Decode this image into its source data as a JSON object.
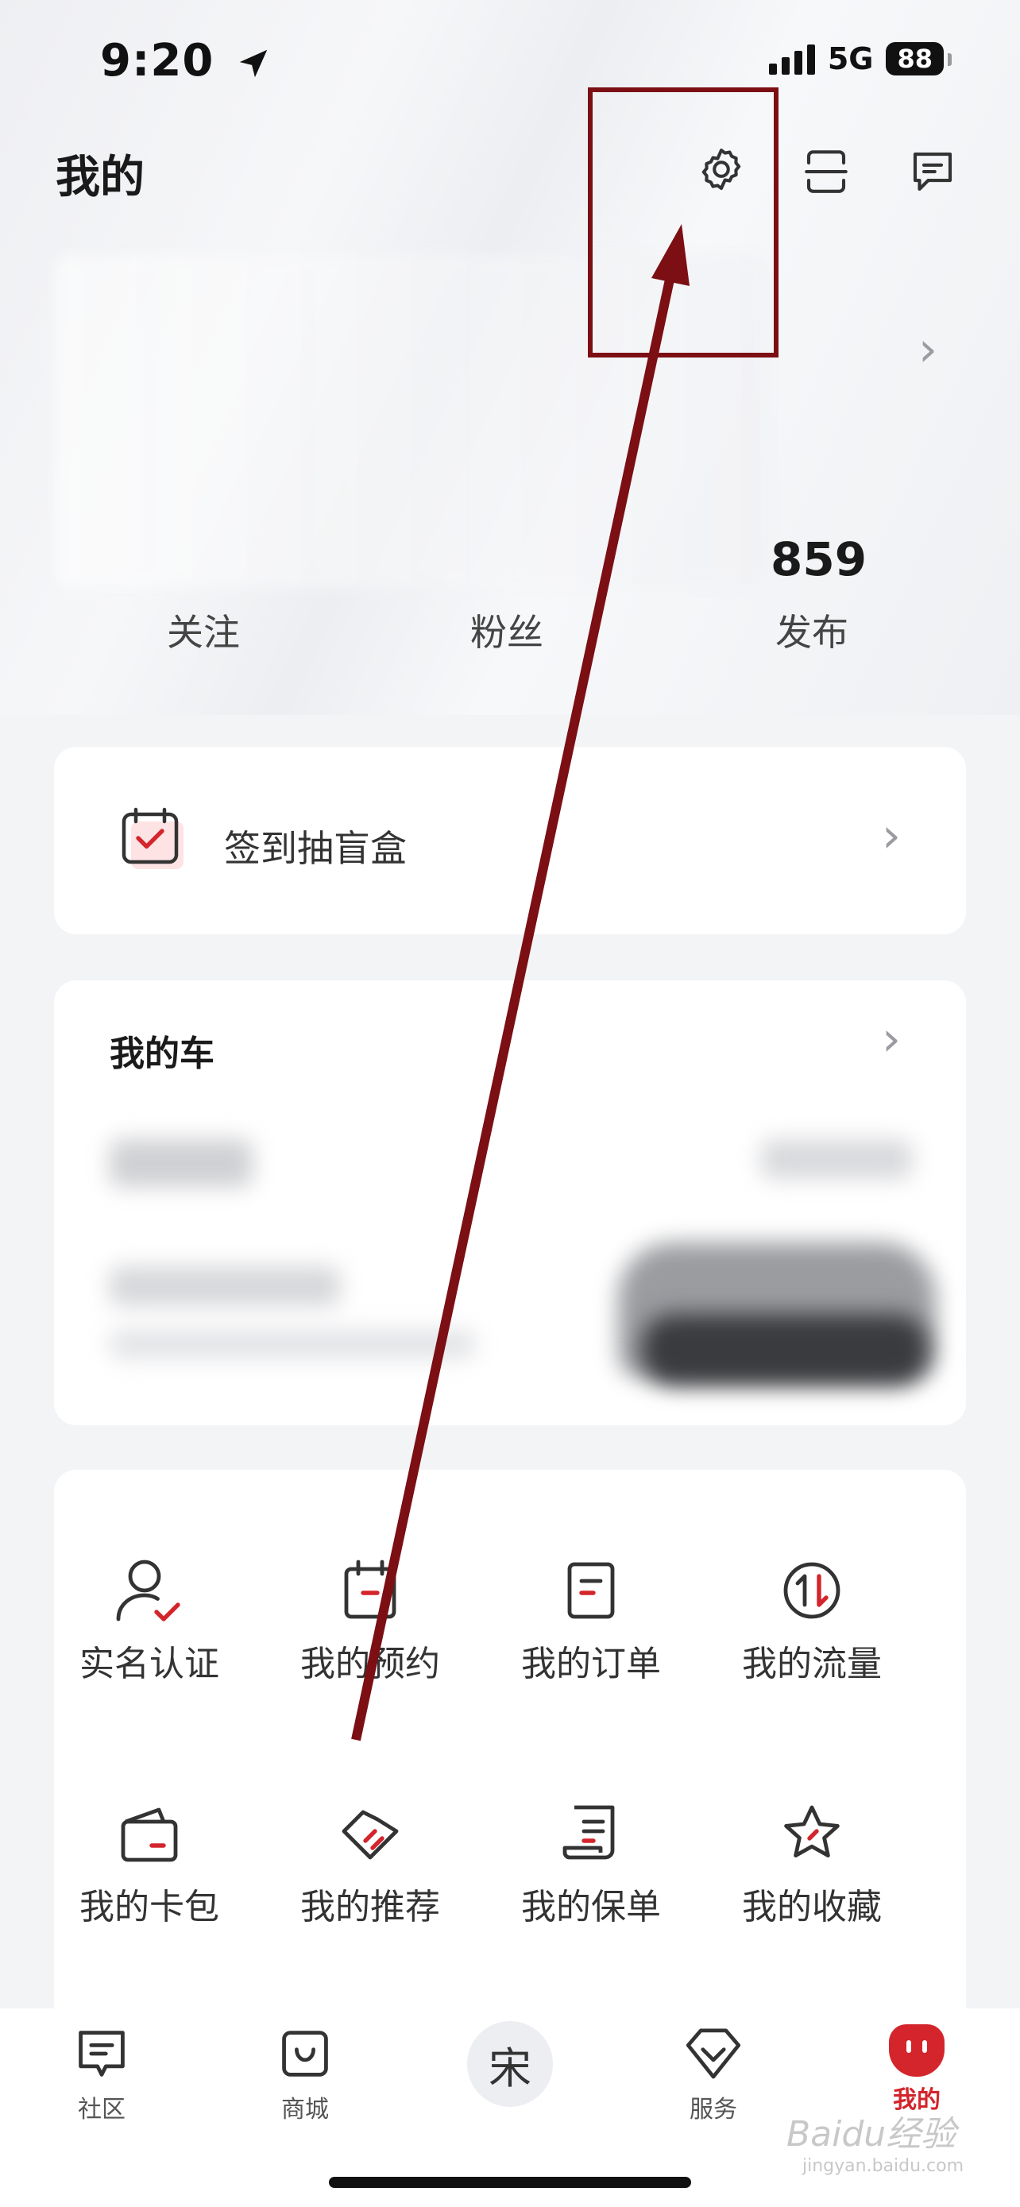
{
  "status_bar": {
    "time": "9:20",
    "network": "5G",
    "battery": "88"
  },
  "header": {
    "title": "我的"
  },
  "profile": {
    "stats": [
      {
        "value": "",
        "label": "关注"
      },
      {
        "value": "",
        "label": "粉丝"
      },
      {
        "value": "859",
        "label": "发布"
      }
    ]
  },
  "checkin": {
    "label": "签到抽盲盒"
  },
  "my_car": {
    "title": "我的车"
  },
  "services": [
    {
      "label": "实名认证",
      "icon": "verify-user-icon"
    },
    {
      "label": "我的预约",
      "icon": "calendar-icon"
    },
    {
      "label": "我的订单",
      "icon": "order-icon"
    },
    {
      "label": "我的流量",
      "icon": "data-flow-icon"
    },
    {
      "label": "我的卡包",
      "icon": "wallet-icon"
    },
    {
      "label": "我的推荐",
      "icon": "handshake-icon"
    },
    {
      "label": "我的保单",
      "icon": "policy-scroll-icon"
    },
    {
      "label": "我的收藏",
      "icon": "star-icon"
    }
  ],
  "tabbar": {
    "items": [
      {
        "label": "社区",
        "icon": "community-icon",
        "active": false
      },
      {
        "label": "商城",
        "icon": "shop-bag-icon",
        "active": false
      },
      {
        "label": "",
        "icon": "song-logo-icon",
        "center_char": "宋",
        "active": false
      },
      {
        "label": "服务",
        "icon": "service-icon",
        "active": false
      },
      {
        "label": "我的",
        "icon": "mine-icon",
        "active": true
      }
    ]
  },
  "colors": {
    "accent": "#d3252b",
    "annotation": "#7b0f14",
    "card": "#ffffff",
    "background": "#f3f4f6"
  },
  "watermark": {
    "text": "Baidu经验",
    "sub": "jingyan.baidu.com"
  }
}
